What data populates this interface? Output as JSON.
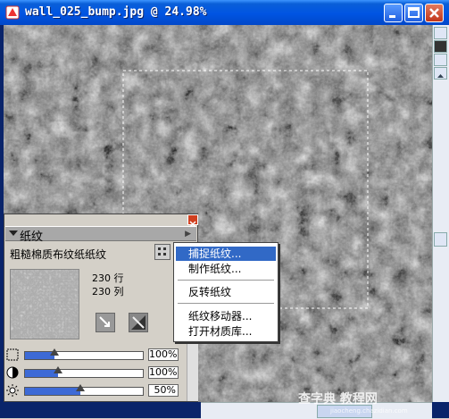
{
  "window": {
    "title": "wall_025_bump.jpg @ 24.98%",
    "minimize_glyph": "_",
    "maximize_glyph": "□",
    "close_glyph": "×"
  },
  "paper_panel": {
    "title": "纸纹",
    "paper_name": "粗糙棉质布纹纸纸纹",
    "rows": "230 行",
    "cols": "230 列",
    "sliders": [
      {
        "icon": "scale-icon",
        "level": 0.25,
        "value": "100%"
      },
      {
        "icon": "contrast-icon",
        "level": 0.28,
        "value": "100%"
      },
      {
        "icon": "brightness-icon",
        "level": 0.47,
        "value": "50%"
      }
    ]
  },
  "context_menu": {
    "items": [
      {
        "label": "捕捉纸纹...",
        "selected": true
      },
      {
        "label": "制作纸纹...",
        "selected": false
      },
      {
        "label": "反转纸纹",
        "selected": false
      },
      {
        "label": "纸纹移动器...",
        "selected": false
      },
      {
        "label": "打开材质库...",
        "selected": false
      }
    ]
  },
  "watermark": {
    "text": "查字典 教程网",
    "url": "jiaocheng.chazidian.com"
  },
  "colors": {
    "titlebar": "#0054e3",
    "menu_highlight": "#3169c6",
    "slider_fill": "#3d6ad6"
  }
}
